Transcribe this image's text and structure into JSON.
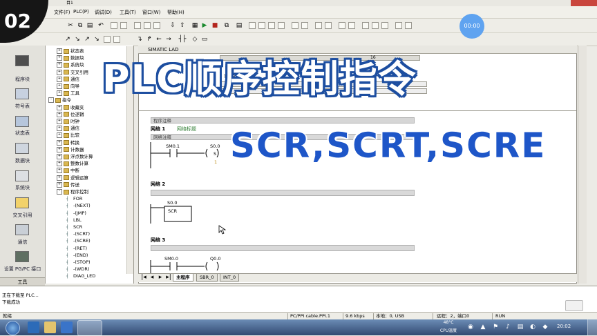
{
  "window": {
    "title_fragment": "目1"
  },
  "menu": {
    "items": [
      "文件(F)",
      "PLC(P)",
      "调试(D)",
      "工具(T)",
      "窗口(W)",
      "帮助(H)"
    ]
  },
  "toolbar": {
    "timer_value": "00:00"
  },
  "episode_badge": "02",
  "nav_bar": {
    "items": [
      "程序块",
      "符号表",
      "状态表",
      "数据块",
      "系统块",
      "交叉引用",
      "通信",
      "设置 PG/PC 接口"
    ],
    "footer": "工具"
  },
  "tree": {
    "rows": [
      {
        "label": "状态表",
        "kind": "folder",
        "toggle": "+"
      },
      {
        "label": "数据块",
        "kind": "folder",
        "toggle": "+"
      },
      {
        "label": "系统块",
        "kind": "folder",
        "toggle": "+"
      },
      {
        "label": "交叉引用",
        "kind": "folder",
        "toggle": "+"
      },
      {
        "label": "通信",
        "kind": "folder",
        "toggle": "+"
      },
      {
        "label": "向导",
        "kind": "folder",
        "toggle": "+"
      },
      {
        "label": "工具",
        "kind": "folder",
        "toggle": "+"
      },
      {
        "label": "指令",
        "kind": "folder",
        "toggle": "-"
      },
      {
        "label": "收藏夹",
        "kind": "folder",
        "toggle": "+"
      },
      {
        "label": "位逻辑",
        "kind": "folder",
        "toggle": "+"
      },
      {
        "label": "时钟",
        "kind": "folder",
        "toggle": "+"
      },
      {
        "label": "通信",
        "kind": "folder",
        "toggle": "+"
      },
      {
        "label": "比较",
        "kind": "folder",
        "toggle": "+"
      },
      {
        "label": "转换",
        "kind": "folder",
        "toggle": "+"
      },
      {
        "label": "计数器",
        "kind": "folder",
        "toggle": "+"
      },
      {
        "label": "浮点数计算",
        "kind": "folder",
        "toggle": "+"
      },
      {
        "label": "整数计算",
        "kind": "folder",
        "toggle": "+"
      },
      {
        "label": "中断",
        "kind": "folder",
        "toggle": "+"
      },
      {
        "label": "逻辑运算",
        "kind": "folder",
        "toggle": "+"
      },
      {
        "label": "传送",
        "kind": "folder",
        "toggle": "+"
      },
      {
        "label": "程序控制",
        "kind": "folder",
        "toggle": "-"
      },
      {
        "label": "FOR",
        "kind": "instr",
        "toggle": ""
      },
      {
        "label": "-(NEXT)",
        "kind": "instr",
        "toggle": ""
      },
      {
        "label": "-(JMP)",
        "kind": "instr",
        "toggle": ""
      },
      {
        "label": "LBL",
        "kind": "instr",
        "toggle": ""
      },
      {
        "label": "SCR",
        "kind": "instr",
        "toggle": ""
      },
      {
        "label": "-(SCRT)",
        "kind": "instr",
        "toggle": ""
      },
      {
        "label": "-(SCRE)",
        "kind": "instr",
        "toggle": ""
      },
      {
        "label": "-(RET)",
        "kind": "instr",
        "toggle": ""
      },
      {
        "label": "-(END)",
        "kind": "instr",
        "toggle": ""
      },
      {
        "label": "-(STOP)",
        "kind": "instr",
        "toggle": ""
      },
      {
        "label": "-(WDR)",
        "kind": "instr",
        "toggle": ""
      },
      {
        "label": "DIAG_LED",
        "kind": "instr",
        "toggle": ""
      }
    ]
  },
  "editor": {
    "window_title": "SIMATIC LAD",
    "var_header": "TEMP",
    "ruler_mark": "16",
    "program_comment": "程序注释",
    "networks": [
      {
        "label": "网络 1",
        "title": "网络标题",
        "comment": "网络注释",
        "contact": "SM0.1",
        "coil": "S0.0",
        "coil_type": "S",
        "coil_param": "1"
      },
      {
        "label": "网络 2",
        "box_operand": "S0.0",
        "box_name": "SCR"
      },
      {
        "label": "网络 3",
        "contact": "SM0.0",
        "coil": "Q0.0"
      }
    ],
    "tabs": [
      "主程序",
      "SBR_0",
      "INT_0"
    ]
  },
  "output": {
    "lines": [
      "正在下载至 PLC...",
      "下载成功"
    ]
  },
  "status": {
    "left": "就绪",
    "connection": "PC/PPI cable.PPI.1",
    "baud": "9.6 kbps",
    "local": "本地：0, USB",
    "remote": "远程：2，端口0",
    "mode": "RUN"
  },
  "taskbar": {
    "temperature": "48°C",
    "cpu_label": "CPU温度",
    "time": "20:02"
  },
  "overlay": {
    "title": "PLC顺序控制指令",
    "subtitle": "SCR,SCRT,SCRE"
  }
}
